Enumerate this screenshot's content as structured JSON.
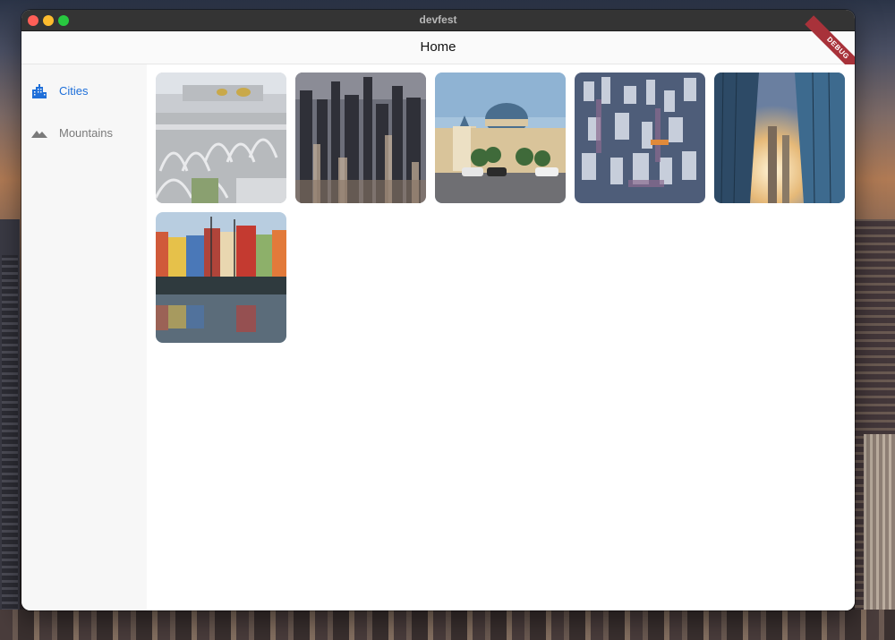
{
  "window": {
    "title": "devfest"
  },
  "appbar": {
    "title": "Home",
    "debug_label": "DEBUG"
  },
  "nav": {
    "items": [
      {
        "label": "Cities",
        "icon": "city-icon",
        "selected": true
      },
      {
        "label": "Mountains",
        "icon": "mountain-icon",
        "selected": false
      }
    ]
  },
  "colors": {
    "accent": "#1e6fd9",
    "rail_bg": "#f7f7f7",
    "debug": "#a8323a"
  },
  "gallery": {
    "items": [
      {
        "icon": "city-photo-futuristic-arches"
      },
      {
        "icon": "city-photo-manhattan-skyline"
      },
      {
        "icon": "city-photo-domed-mosque"
      },
      {
        "icon": "city-photo-aerial-skyscrapers"
      },
      {
        "icon": "city-photo-glass-towers-sunset"
      },
      {
        "icon": "city-photo-colorful-harbor"
      }
    ]
  }
}
